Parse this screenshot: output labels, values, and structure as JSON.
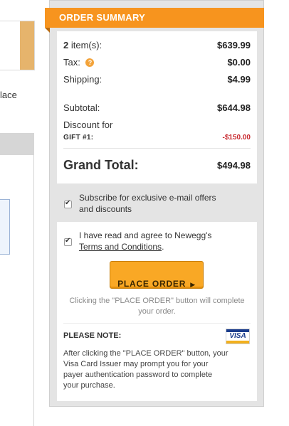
{
  "left": {
    "place_fragment": "lace"
  },
  "summary": {
    "title": "ORDER SUMMARY",
    "items_count": "2",
    "items_label": "item(s):",
    "items_value": "$639.99",
    "tax_label": "Tax:",
    "tax_help": "?",
    "tax_value": "$0.00",
    "shipping_label": "Shipping:",
    "shipping_value": "$4.99",
    "subtotal_label": "Subtotal:",
    "subtotal_value": "$644.98",
    "discount_label": "Discount for",
    "gift_label": "GIFT #1:",
    "discount_value": "-$150.00",
    "grand_total_label": "Grand Total:",
    "grand_total_value": "$494.98"
  },
  "subscribe": {
    "checked": true,
    "line1": "Subscribe for exclusive e-mail offers",
    "line2": "and discounts"
  },
  "agree": {
    "checked": true,
    "line1": "I have read and agree to Newegg's",
    "terms_link": "Terms and Conditions",
    "period": "."
  },
  "place_order": {
    "label": "PLACE ORDER",
    "arrow": "▶",
    "note_line1": "Clicking the \"PLACE ORDER\" button will complete",
    "note_line2": "your order."
  },
  "notice": {
    "title": "PLEASE NOTE:",
    "visa_logo_text": "VISA",
    "line1": "After clicking the \"PLACE ORDER\" button, your",
    "line2": "Visa Card Issuer may prompt you for your",
    "line3": "payer authentication password to complete",
    "line4": "your purchase."
  },
  "colors": {
    "header_orange": "#f7941e",
    "button_orange": "#f9a825",
    "discount_red": "#c8272d",
    "panel_gray": "#e4e4e4"
  }
}
